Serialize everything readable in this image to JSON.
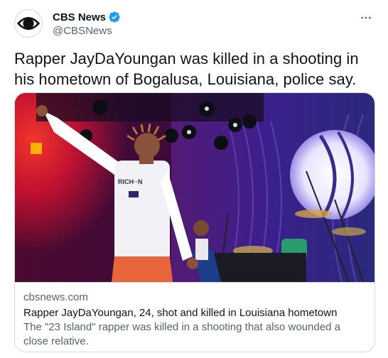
{
  "author": {
    "display_name": "CBS News",
    "handle": "@CBSNews",
    "verified": true,
    "avatar_icon": "cbs-eye-logo-icon"
  },
  "tweet": {
    "text": "Rapper JayDaYoungan was killed in a shooting in his hometown of Bogalusa, Louisiana, police say."
  },
  "card": {
    "domain": "cbsnews.com",
    "title": "Rapper JayDaYoungan, 24, shot and killed in Louisiana hometown",
    "description": "The \"23 Island\" rapper was killed in a shooting that also wounded a close relative.",
    "image_alt": "Performer on stage with stage lights and a drummer behind",
    "shirt_text": "RICH··N"
  },
  "colors": {
    "verified_blue": "#1d9bf0",
    "text_primary": "#0f1419",
    "text_secondary": "#536471",
    "border": "#cfd9de"
  },
  "icons": {
    "more": "more-options-icon",
    "verified": "verified-badge-icon"
  }
}
